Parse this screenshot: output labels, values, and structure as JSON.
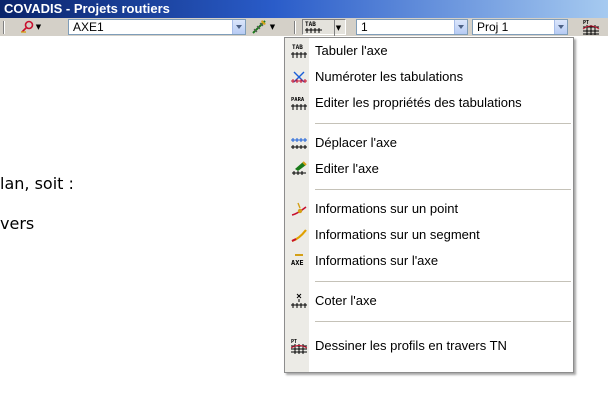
{
  "window": {
    "title": "COVADIS - Projets routiers"
  },
  "toolbar": {
    "axis_combo": "AXE1",
    "tabulation_combo": "1",
    "project_combo": "Proj 1",
    "icons": [
      "point-tool-icon",
      "axis-edit-icon",
      "tab-axis-icon",
      "profile-draw-icon"
    ]
  },
  "document": {
    "line1": "lan, soit :",
    "line2": "vers"
  },
  "menu": {
    "items": [
      {
        "icon": "tab-axis-icon",
        "label": "Tabuler l'axe"
      },
      {
        "icon": "number-tabs-icon",
        "label": "Numéroter les tabulations"
      },
      {
        "icon": "tab-properties-icon",
        "label": "Editer les propriétés des tabulations"
      },
      {
        "icon": "move-axis-icon",
        "label": "Déplacer l'axe"
      },
      {
        "icon": "edit-axis-icon",
        "label": "Editer l'axe"
      },
      {
        "icon": "point-info-icon",
        "label": "Informations sur un point"
      },
      {
        "icon": "segment-info-icon",
        "label": "Informations sur un segment"
      },
      {
        "icon": "axis-info-icon",
        "label": "Informations sur l'axe"
      },
      {
        "icon": "dimension-axis-icon",
        "label": "Coter l'axe"
      },
      {
        "icon": "draw-profiles-icon",
        "label": "Dessiner les profils en travers TN"
      }
    ]
  },
  "colors": {
    "title_gradient_start": "#0a246a",
    "title_gradient_end": "#a6caf0",
    "toolbar_bg": "#d4d0c8",
    "menu_strip": "#ecebe6"
  }
}
